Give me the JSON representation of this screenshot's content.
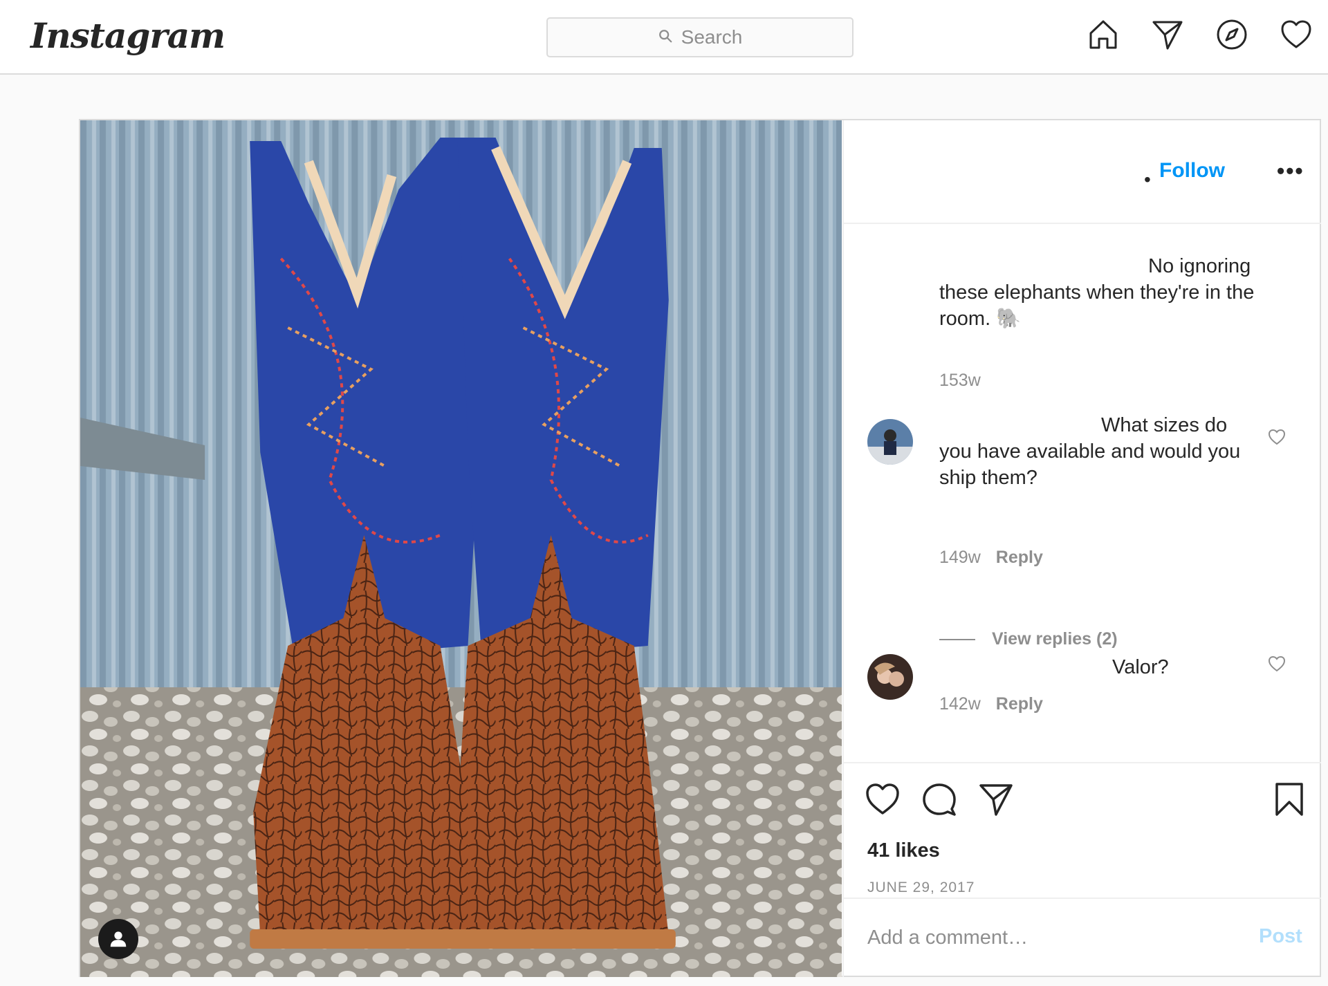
{
  "nav": {
    "logo": "Instagram",
    "search_placeholder": "Search",
    "icons": [
      "home-icon",
      "direct-message-icon",
      "explore-icon",
      "activity-heart-icon"
    ]
  },
  "post": {
    "header": {
      "dot": "•",
      "follow_label": "Follow",
      "more_label": "•••"
    },
    "caption": {
      "line1": "No ignoring",
      "rest": "these elephants when they're in the room. 🐘"
    },
    "caption_age": "153w",
    "comments": [
      {
        "text_line1": "What sizes do",
        "text_rest": "you have available and would you ship them?",
        "age": "149w",
        "reply_label": "Reply",
        "view_replies": "View replies (2)"
      },
      {
        "text_line1": "Valor?",
        "age": "142w",
        "reply_label": "Reply"
      }
    ],
    "likes": "41 likes",
    "date": "JUNE 29, 2017",
    "add_comment_placeholder": "Add a comment…",
    "post_button": "Post"
  },
  "colors": {
    "follow_blue": "#0095f6",
    "post_disabled": "#b2dffc",
    "muted": "#8e8e8e",
    "border": "#dbdbdb"
  }
}
